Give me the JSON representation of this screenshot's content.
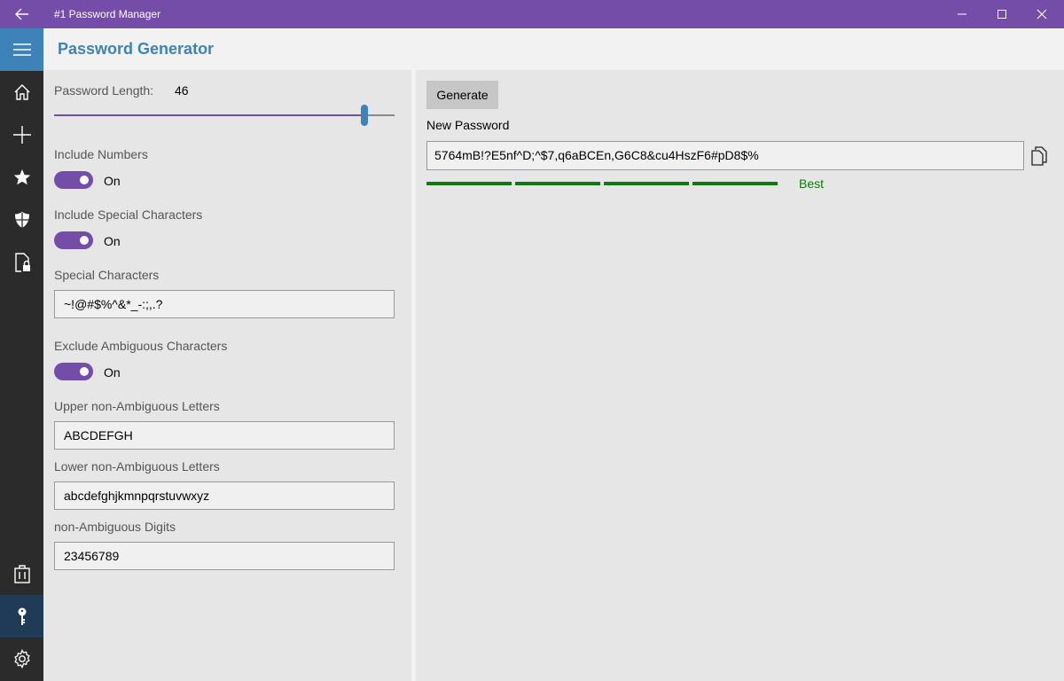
{
  "window": {
    "title": "#1 Password Manager",
    "icons": {
      "back": "back-arrow-icon",
      "minimize": "minimize-icon",
      "maximize": "maximize-icon",
      "close": "close-icon"
    }
  },
  "rail": {
    "items": [
      {
        "name": "hamburger-menu",
        "icon": "hamburger-icon"
      },
      {
        "name": "home",
        "icon": "home-icon"
      },
      {
        "name": "add",
        "icon": "plus-icon"
      },
      {
        "name": "favorites",
        "icon": "star-icon"
      },
      {
        "name": "security",
        "icon": "shield-icon"
      },
      {
        "name": "locked-document",
        "icon": "document-lock-icon"
      },
      {
        "name": "clipboard",
        "icon": "clipboard-icon"
      },
      {
        "name": "password-generator",
        "icon": "key-icon",
        "active": true
      },
      {
        "name": "settings",
        "icon": "gear-icon"
      }
    ]
  },
  "header": {
    "title": "Password Generator"
  },
  "options": {
    "length_label": "Password Length:",
    "length_value": "46",
    "length_slider": {
      "min": 0,
      "max": 50,
      "value": 46
    },
    "include_numbers": {
      "label": "Include Numbers",
      "state": "On"
    },
    "include_special": {
      "label": "Include Special Characters",
      "state": "On"
    },
    "special_chars": {
      "label": "Special Characters",
      "value": "~!@#$%^&*_-:;,.?"
    },
    "exclude_ambiguous": {
      "label": "Exclude Ambiguous Characters",
      "state": "On"
    },
    "upper_letters": {
      "label": "Upper non-Ambiguous Letters",
      "value": "ABCDEFGH"
    },
    "lower_letters": {
      "label": "Lower non-Ambiguous Letters",
      "value": "abcdefghjkmnpqrstuvwxyz"
    },
    "digits": {
      "label": "non-Ambiguous Digits",
      "value": "23456789"
    }
  },
  "generator": {
    "generate_label": "Generate",
    "new_password_label": "New Password",
    "password": "5764mB!?E5nf^D;^$7,q6aBCEn,G6C8&cu4HszF6#pD8$%",
    "strength_label": "Best",
    "strength_segments": 4,
    "colors": {
      "accent": "#744da9",
      "brand": "#3d82b8",
      "strength": "#0a7d0a"
    }
  }
}
